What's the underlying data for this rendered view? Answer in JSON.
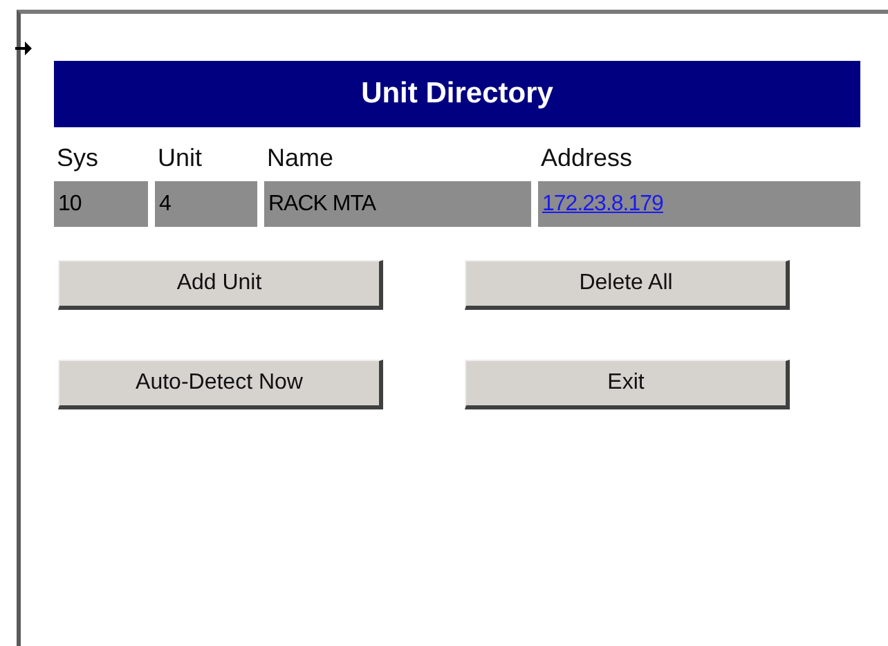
{
  "title": "Unit Directory",
  "columns": [
    "Sys",
    "Unit",
    "Name",
    "Address"
  ],
  "rows": [
    {
      "sys": "10",
      "unit": "4",
      "name": "RACK MTA",
      "address": "172.23.8.179"
    }
  ],
  "buttons": [
    {
      "label": "Add Unit"
    },
    {
      "label": "Delete All"
    },
    {
      "label": "Auto-Detect Now"
    },
    {
      "label": "Exit"
    }
  ]
}
